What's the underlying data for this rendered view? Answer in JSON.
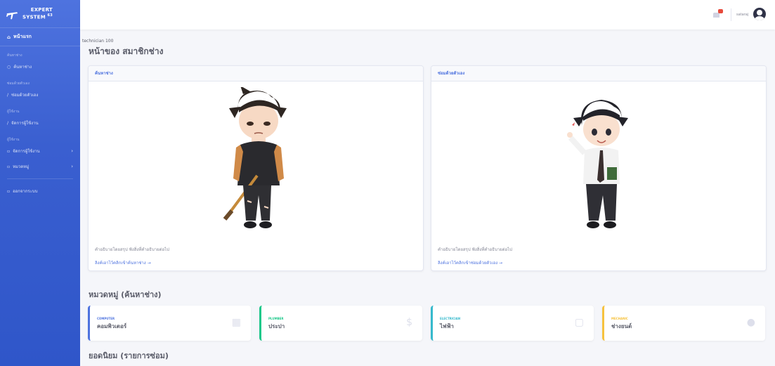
{
  "brand": {
    "line1": "EXPERT",
    "line2": "SYSTEM",
    "sup": "63"
  },
  "sidebar": {
    "home_label": "หน้าแรก",
    "heading_search": "ค้นหาช่าง",
    "item_search": "ค้นหาช่าง",
    "heading_self_repair": "ซ่อมด้วยตัวเอง",
    "item_self_repair": "ซ่อมด้วยตัวเอง",
    "heading_manage": "ผู้ใช้งาน",
    "item_manage": "จัดการผู้ใช้งาน",
    "heading_manage2": "ผู้ใช้งาน",
    "item_manage2": "จัดการผู้ใช้งาน",
    "item_category": "หมวดหมู่",
    "item_logout": "ออกจากระบบ"
  },
  "topbar": {
    "user_name": "sataraj"
  },
  "breadcrumb": "technician 100",
  "page_title": "หน้าของ สมาชิกช่าง",
  "cards": [
    {
      "header": "ค้นหาช่าง",
      "desc": "คำอธิบายโดยสรุป ฟังสิ่งที่คำอธิบายต่อไป",
      "link": "ลิงค์เอาไว้คลิกเข้าค้นหาช่าง →"
    },
    {
      "header": "ซ่อมด้วยตัวเอง",
      "desc": "คำอธิบายโดยสรุป ฟังสิ่งที่คำอธิบายต่อไป",
      "link": "ลิงค์เอาไว้คลิกเข้าซ่อมด้วยตัวเอง →"
    }
  ],
  "section_category": "หมวดหมู่ (ค้นหาช่าง)",
  "stats": [
    {
      "label": "COMPUTER",
      "value": "คอมพิวเตอร์",
      "color": "#4e73df",
      "icon": "calendar-icon"
    },
    {
      "label": "PLUMBER",
      "value": "ประปา",
      "color": "#1cc88a",
      "icon": "dollar-icon"
    },
    {
      "label": "ELECTRICIAN",
      "value": "ไฟฟ้า",
      "color": "#36b9cc",
      "icon": "clipboard-icon"
    },
    {
      "label": "MECHANIC",
      "value": "ช่างยนต์",
      "color": "#f6c23e",
      "icon": "comments-icon"
    }
  ],
  "section_popular": "ยอดนิยม (รายการซ่อม)"
}
